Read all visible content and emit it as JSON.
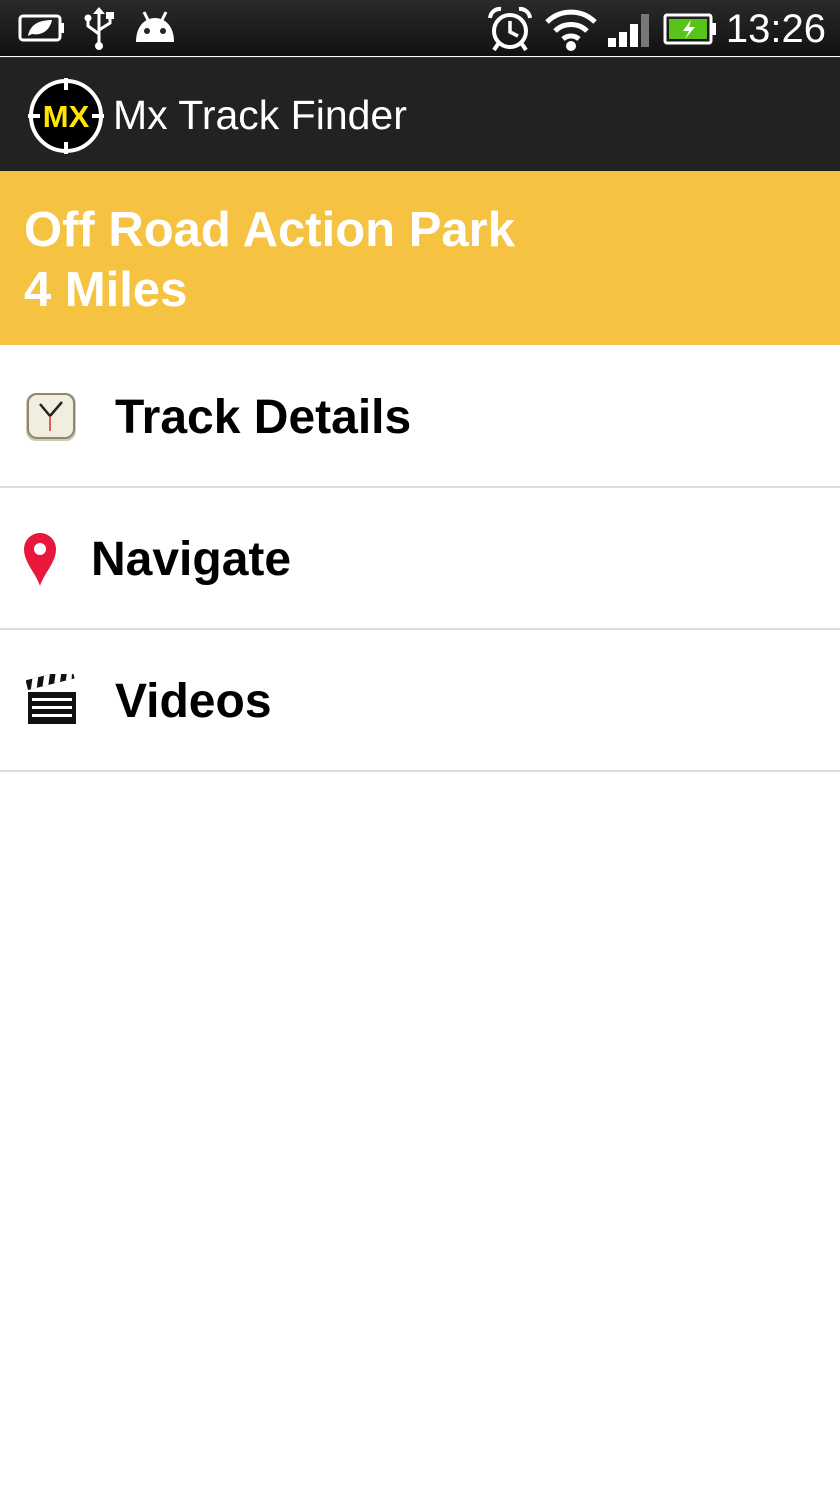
{
  "status_bar": {
    "time": "13:26",
    "icons": [
      "battery-saver-icon",
      "usb-icon",
      "android-icon",
      "alarm-icon",
      "wifi-icon",
      "signal-icon",
      "battery-charging-icon"
    ]
  },
  "app_bar": {
    "logo_text": "MX",
    "title": "Mx Track Finder"
  },
  "track": {
    "name": "Off Road Action Park",
    "distance": "4 Miles"
  },
  "menu": {
    "items": [
      {
        "label": "Track Details",
        "icon": "clock-icon"
      },
      {
        "label": "Navigate",
        "icon": "map-pin-icon"
      },
      {
        "label": "Videos",
        "icon": "clapperboard-icon"
      }
    ]
  },
  "colors": {
    "header_background": "#f5c242",
    "action_bar": "#222222",
    "pin": "#e8173b",
    "logo_yellow": "#ffe500"
  }
}
